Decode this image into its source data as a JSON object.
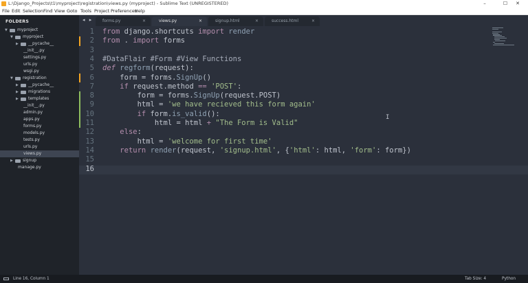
{
  "window": {
    "title": "L:\\Django_Projects\\t1\\myproject\\registration\\views.py (myproject) - Sublime Text (UNREGISTERED)",
    "minimize_glyph": "–",
    "maximize_glyph": "☐",
    "close_glyph": "✕"
  },
  "menu": [
    "File",
    "Edit",
    "Selection",
    "Find",
    "View",
    "Goto",
    "Tools",
    "Project",
    "Preferences",
    "Help"
  ],
  "sidebar": {
    "header": "FOLDERS",
    "items": [
      {
        "label": "myproject",
        "type": "folder",
        "open": true
      },
      {
        "label": "myproject",
        "type": "folder",
        "open": true
      },
      {
        "label": "__pycache__",
        "type": "folder",
        "open": false
      },
      {
        "label": "__init__.py",
        "type": "file"
      },
      {
        "label": "settings.py",
        "type": "file"
      },
      {
        "label": "urls.py",
        "type": "file"
      },
      {
        "label": "wsgi.py",
        "type": "file"
      },
      {
        "label": "registration",
        "type": "folder",
        "open": true
      },
      {
        "label": "__pycache__",
        "type": "folder",
        "open": false
      },
      {
        "label": "migrations",
        "type": "folder",
        "open": false
      },
      {
        "label": "templates",
        "type": "folder",
        "open": false
      },
      {
        "label": "__init__.py",
        "type": "file"
      },
      {
        "label": "admin.py",
        "type": "file"
      },
      {
        "label": "apps.py",
        "type": "file"
      },
      {
        "label": "forms.py",
        "type": "file"
      },
      {
        "label": "models.py",
        "type": "file"
      },
      {
        "label": "tests.py",
        "type": "file"
      },
      {
        "label": "urls.py",
        "type": "file"
      },
      {
        "label": "views.py",
        "type": "file",
        "selected": true
      },
      {
        "label": "signup",
        "type": "folder",
        "open": false
      },
      {
        "label": "manage.py",
        "type": "file"
      }
    ]
  },
  "tabs": [
    {
      "label": "forms.py",
      "active": false
    },
    {
      "label": "views.py",
      "active": true
    },
    {
      "label": "signup.html",
      "active": false
    },
    {
      "label": "success.html",
      "active": false
    }
  ],
  "tab_close_glyph": "×",
  "nav_arrows": "◂ ▸",
  "editor": {
    "current_line": 16,
    "lines": [
      "from django.shortcuts import render",
      "from . import forms",
      "",
      "#DataFlair #Form #View Functions",
      "def regform(request):",
      "    form = forms.SignUp()",
      "    if request.method == 'POST':",
      "        form = forms.SignUp(request.POST)",
      "        html = 'we have recieved this form again'",
      "        if form.is_valid():",
      "            html = html + \"The Form is Valid\"",
      "    else:",
      "        html = 'welcome for first time'",
      "    return render(request, 'signup.html', {'html': html, 'form': form})",
      "",
      ""
    ],
    "modified_lines": {
      "2": "#f5a623",
      "6": "#f5a623",
      "8": "#8fbf5f",
      "9": "#8fbf5f",
      "10": "#8fbf5f",
      "11": "#8fbf5f"
    },
    "cursor_glyph": "I"
  },
  "status": {
    "position": "Line 16, Column 1",
    "tab_size": "Tab Size: 4",
    "syntax": "Python"
  }
}
